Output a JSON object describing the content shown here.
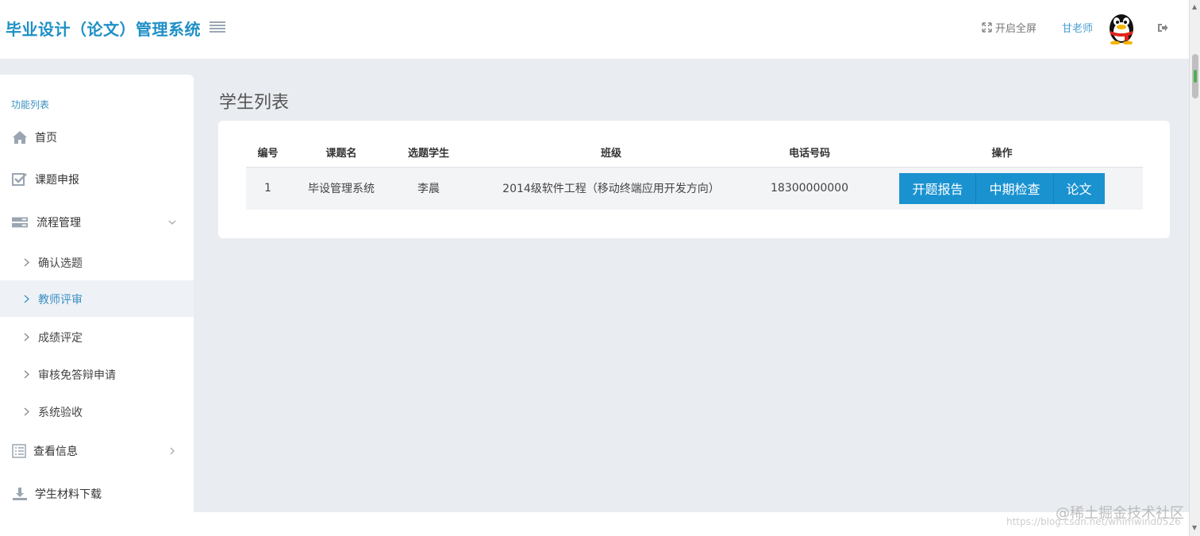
{
  "header": {
    "title": "毕业设计（论文）管理系统",
    "fullscreen_label": "开启全屏",
    "user_name": "甘老师"
  },
  "sidebar": {
    "heading": "功能列表",
    "items": [
      {
        "label": "首页",
        "icon": "home-icon"
      },
      {
        "label": "课题申报",
        "icon": "checkbox-icon"
      },
      {
        "label": "流程管理",
        "icon": "server-icon",
        "expanded": true
      },
      {
        "label": "查看信息",
        "icon": "list-icon"
      },
      {
        "label": "学生材料下载",
        "icon": "download-icon"
      }
    ],
    "sub_items": [
      {
        "label": "确认选题",
        "active": false
      },
      {
        "label": "教师评审",
        "active": true
      },
      {
        "label": "成绩评定",
        "active": false
      },
      {
        "label": "审核免答辩申请",
        "active": false
      },
      {
        "label": "系统验收",
        "active": false
      }
    ]
  },
  "main": {
    "page_title": "学生列表",
    "table": {
      "headers": [
        "编号",
        "课题名",
        "选题学生",
        "班级",
        "电话号码",
        "操作"
      ],
      "rows": [
        {
          "id": "1",
          "topic": "毕设管理系统",
          "student": "李晨",
          "class": "2014级软件工程（移动终端应用开发方向）",
          "phone": "18300000000"
        }
      ]
    },
    "actions": [
      "开题报告",
      "中期检查",
      "论文"
    ]
  },
  "watermark": {
    "line1": "@稀土掘金技术社区",
    "line2": "https://blog.csdn.net/whimwind0526"
  },
  "colors": {
    "accent": "#1e8fc6",
    "button": "#1a92d0",
    "background": "#e9ecf0"
  }
}
